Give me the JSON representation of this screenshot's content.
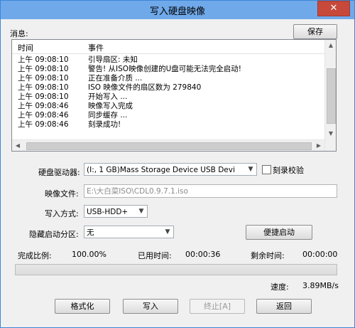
{
  "window": {
    "title": "写入硬盘映像",
    "close_glyph": "✕"
  },
  "messages": {
    "label": "消息:",
    "save_button": "保存",
    "columns": {
      "time": "时间",
      "event": "事件"
    },
    "rows": [
      {
        "time": "上午 09:08:10",
        "event": "引导扇区: 未知"
      },
      {
        "time": "上午 09:08:10",
        "event": "警告! 从ISO映像创建的U盘可能无法完全启动!"
      },
      {
        "time": "上午 09:08:10",
        "event": "正在准备介质 ..."
      },
      {
        "time": "上午 09:08:10",
        "event": "ISO 映像文件的扇区数为 279840"
      },
      {
        "time": "上午 09:08:10",
        "event": "开始写入 ..."
      },
      {
        "time": "上午 09:08:46",
        "event": "映像写入完成"
      },
      {
        "time": "上午 09:08:46",
        "event": "同步缓存 ..."
      },
      {
        "time": "上午 09:08:46",
        "event": "刻录成功!"
      }
    ],
    "scroll": {
      "up_icon": "▲",
      "down_icon": "▼",
      "left_icon": "◀",
      "right_icon": "▶"
    }
  },
  "form": {
    "drive_label": "硬盘驱动器:",
    "drive_value": "(I:, 1 GB)Mass Storage Device USB Devi",
    "verify_label": "刻录校验",
    "verify_checked": false,
    "image_label": "映像文件:",
    "image_value": "E:\\大白菜ISO\\CDL0.9.7.1.iso",
    "method_label": "写入方式:",
    "method_value": "USB-HDD+",
    "hidden_label": "隐藏启动分区:",
    "hidden_value": "无",
    "quick_boot_button": "便捷启动",
    "dropdown_icon": "▼"
  },
  "status": {
    "progress_label": "完成比例:",
    "progress_value": "100.00%",
    "progress_fraction": 1.0,
    "elapsed_label": "已用时间:",
    "elapsed_value": "00:00:36",
    "remaining_label": "剩余时间:",
    "remaining_value": "00:00:00",
    "speed_label": "速度:",
    "speed_value": "3.89MB/s"
  },
  "actions": {
    "format_button": "格式化",
    "write_button": "写入",
    "stop_button": "终止[A]",
    "back_button": "返回"
  }
}
